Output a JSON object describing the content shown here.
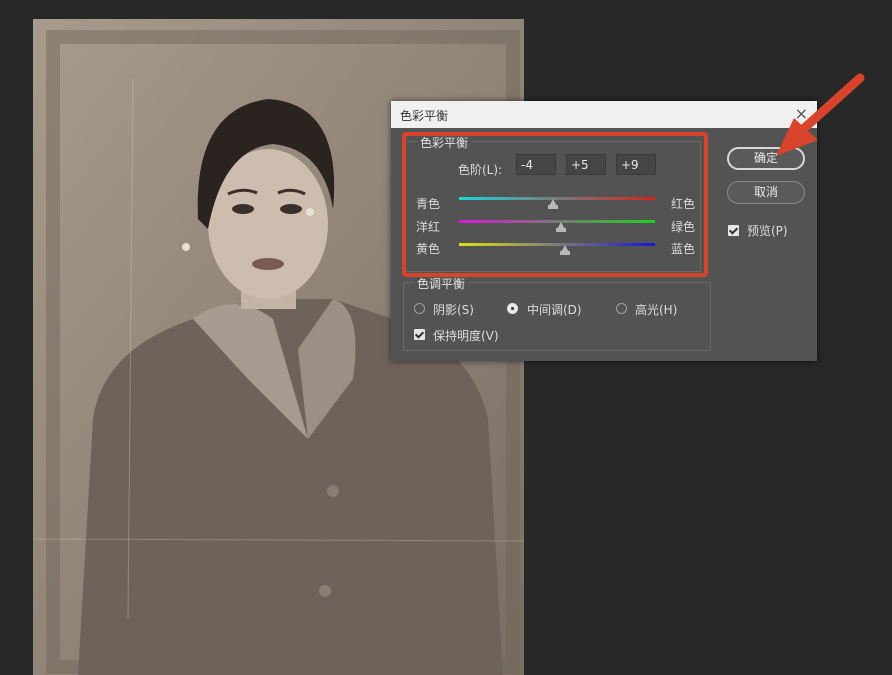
{
  "dialog": {
    "title": "色彩平衡",
    "close_symbol": "×",
    "color_balance_group": "色彩平衡",
    "levels_label": "色阶(L):",
    "levels": [
      "-4",
      "+5",
      "+9"
    ],
    "sliders": [
      {
        "left": "青色",
        "right": "红色",
        "value_fraction": 0.48
      },
      {
        "left": "洋红",
        "right": "绿色",
        "value_fraction": 0.52
      },
      {
        "left": "黄色",
        "right": "蓝色",
        "value_fraction": 0.54
      }
    ],
    "tone_balance_group": "色调平衡",
    "tones": [
      {
        "label": "阴影(S)",
        "selected": false
      },
      {
        "label": "中间调(D)",
        "selected": true
      },
      {
        "label": "高光(H)",
        "selected": false
      }
    ],
    "preserve_luminosity": "保持明度(V)",
    "ok_label": "确定",
    "cancel_label": "取消",
    "preview_label": "预览(P)"
  },
  "colors": {
    "highlight": "#d8432b",
    "cyan_red": [
      "#18d8d8",
      "#d82020"
    ],
    "magenta_green": [
      "#d818d8",
      "#18d818"
    ],
    "yellow_blue": [
      "#e0e018",
      "#1818d8"
    ]
  }
}
